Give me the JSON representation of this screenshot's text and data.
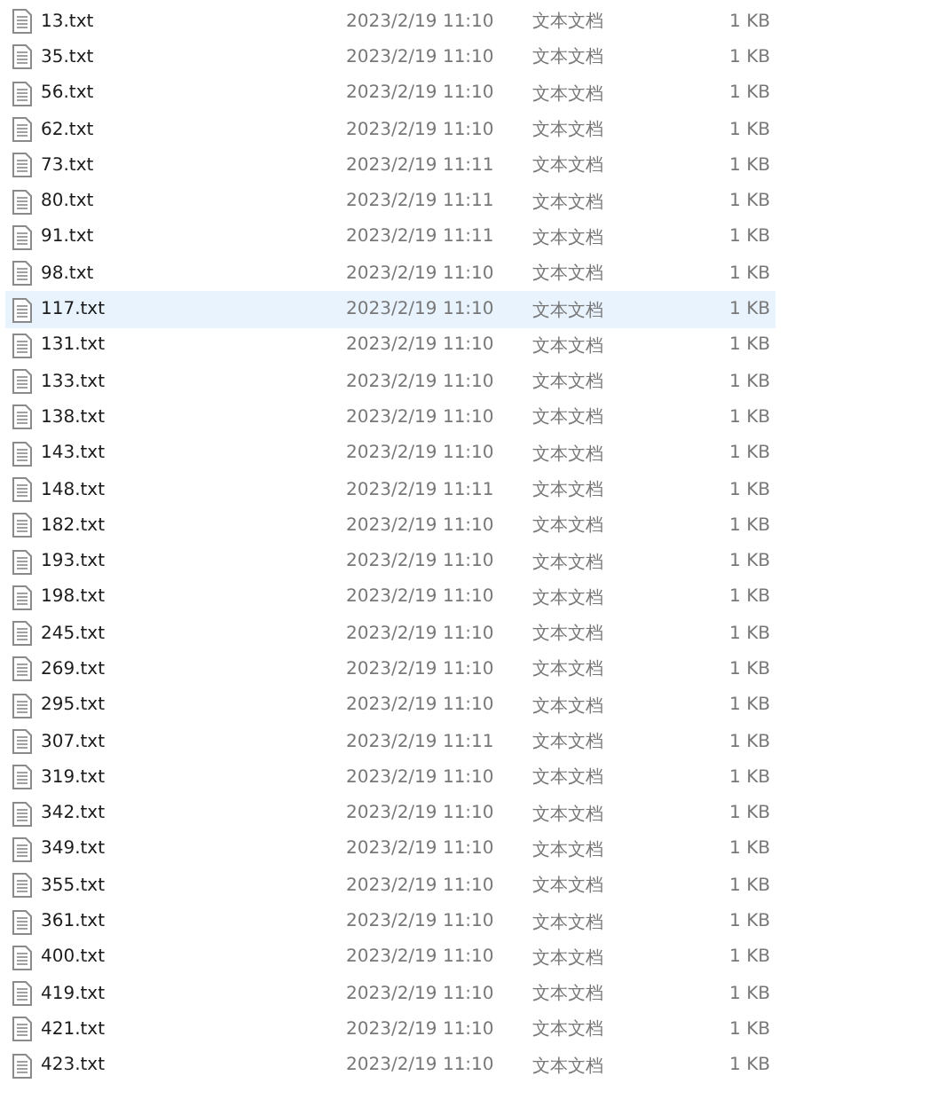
{
  "files": [
    {
      "name": "13.txt",
      "modified": "2023/2/19 11:10",
      "type": "文本文档",
      "size": "1 KB",
      "selected": false
    },
    {
      "name": "35.txt",
      "modified": "2023/2/19 11:10",
      "type": "文本文档",
      "size": "1 KB",
      "selected": false
    },
    {
      "name": "56.txt",
      "modified": "2023/2/19 11:10",
      "type": "文本文档",
      "size": "1 KB",
      "selected": false
    },
    {
      "name": "62.txt",
      "modified": "2023/2/19 11:10",
      "type": "文本文档",
      "size": "1 KB",
      "selected": false
    },
    {
      "name": "73.txt",
      "modified": "2023/2/19 11:11",
      "type": "文本文档",
      "size": "1 KB",
      "selected": false
    },
    {
      "name": "80.txt",
      "modified": "2023/2/19 11:11",
      "type": "文本文档",
      "size": "1 KB",
      "selected": false
    },
    {
      "name": "91.txt",
      "modified": "2023/2/19 11:11",
      "type": "文本文档",
      "size": "1 KB",
      "selected": false
    },
    {
      "name": "98.txt",
      "modified": "2023/2/19 11:10",
      "type": "文本文档",
      "size": "1 KB",
      "selected": false
    },
    {
      "name": "117.txt",
      "modified": "2023/2/19 11:10",
      "type": "文本文档",
      "size": "1 KB",
      "selected": true
    },
    {
      "name": "131.txt",
      "modified": "2023/2/19 11:10",
      "type": "文本文档",
      "size": "1 KB",
      "selected": false
    },
    {
      "name": "133.txt",
      "modified": "2023/2/19 11:10",
      "type": "文本文档",
      "size": "1 KB",
      "selected": false
    },
    {
      "name": "138.txt",
      "modified": "2023/2/19 11:10",
      "type": "文本文档",
      "size": "1 KB",
      "selected": false
    },
    {
      "name": "143.txt",
      "modified": "2023/2/19 11:10",
      "type": "文本文档",
      "size": "1 KB",
      "selected": false
    },
    {
      "name": "148.txt",
      "modified": "2023/2/19 11:11",
      "type": "文本文档",
      "size": "1 KB",
      "selected": false
    },
    {
      "name": "182.txt",
      "modified": "2023/2/19 11:10",
      "type": "文本文档",
      "size": "1 KB",
      "selected": false
    },
    {
      "name": "193.txt",
      "modified": "2023/2/19 11:10",
      "type": "文本文档",
      "size": "1 KB",
      "selected": false
    },
    {
      "name": "198.txt",
      "modified": "2023/2/19 11:10",
      "type": "文本文档",
      "size": "1 KB",
      "selected": false
    },
    {
      "name": "245.txt",
      "modified": "2023/2/19 11:10",
      "type": "文本文档",
      "size": "1 KB",
      "selected": false
    },
    {
      "name": "269.txt",
      "modified": "2023/2/19 11:10",
      "type": "文本文档",
      "size": "1 KB",
      "selected": false
    },
    {
      "name": "295.txt",
      "modified": "2023/2/19 11:10",
      "type": "文本文档",
      "size": "1 KB",
      "selected": false
    },
    {
      "name": "307.txt",
      "modified": "2023/2/19 11:11",
      "type": "文本文档",
      "size": "1 KB",
      "selected": false
    },
    {
      "name": "319.txt",
      "modified": "2023/2/19 11:10",
      "type": "文本文档",
      "size": "1 KB",
      "selected": false
    },
    {
      "name": "342.txt",
      "modified": "2023/2/19 11:10",
      "type": "文本文档",
      "size": "1 KB",
      "selected": false
    },
    {
      "name": "349.txt",
      "modified": "2023/2/19 11:10",
      "type": "文本文档",
      "size": "1 KB",
      "selected": false
    },
    {
      "name": "355.txt",
      "modified": "2023/2/19 11:10",
      "type": "文本文档",
      "size": "1 KB",
      "selected": false
    },
    {
      "name": "361.txt",
      "modified": "2023/2/19 11:10",
      "type": "文本文档",
      "size": "1 KB",
      "selected": false
    },
    {
      "name": "400.txt",
      "modified": "2023/2/19 11:10",
      "type": "文本文档",
      "size": "1 KB",
      "selected": false
    },
    {
      "name": "419.txt",
      "modified": "2023/2/19 11:10",
      "type": "文本文档",
      "size": "1 KB",
      "selected": false
    },
    {
      "name": "421.txt",
      "modified": "2023/2/19 11:10",
      "type": "文本文档",
      "size": "1 KB",
      "selected": false
    },
    {
      "name": "423.txt",
      "modified": "2023/2/19 11:10",
      "type": "文本文档",
      "size": "1 KB",
      "selected": false
    }
  ]
}
